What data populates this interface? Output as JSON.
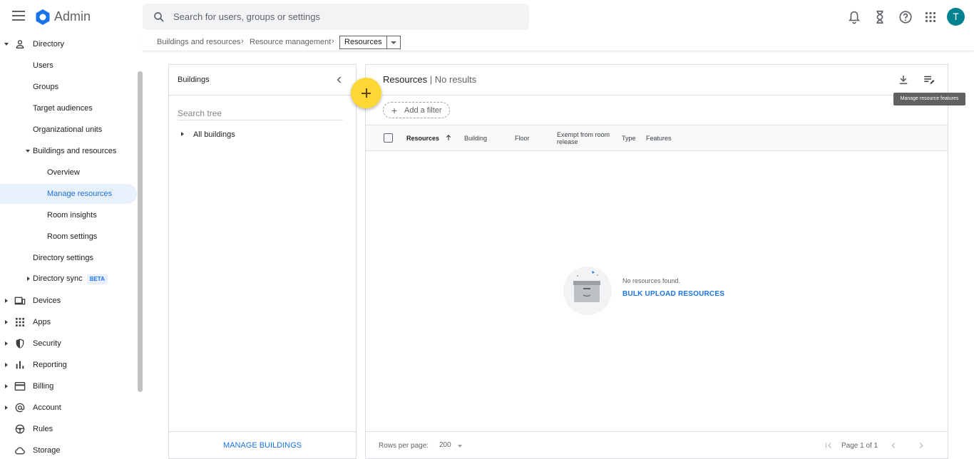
{
  "header": {
    "app_name": "Admin",
    "search_placeholder": "Search for users, groups or settings",
    "avatar_letter": "T"
  },
  "breadcrumb": {
    "items": [
      "Buildings and resources",
      "Resource management"
    ],
    "current": "Resources"
  },
  "sidebar": {
    "items": [
      {
        "label": "Directory"
      },
      {
        "label": "Users"
      },
      {
        "label": "Groups"
      },
      {
        "label": "Target audiences"
      },
      {
        "label": "Organizational units"
      },
      {
        "label": "Buildings and resources"
      },
      {
        "label": "Overview"
      },
      {
        "label": "Manage resources"
      },
      {
        "label": "Room insights"
      },
      {
        "label": "Room settings"
      },
      {
        "label": "Directory settings"
      },
      {
        "label": "Directory sync",
        "badge": "BETA"
      },
      {
        "label": "Devices"
      },
      {
        "label": "Apps"
      },
      {
        "label": "Security"
      },
      {
        "label": "Reporting"
      },
      {
        "label": "Billing"
      },
      {
        "label": "Account"
      },
      {
        "label": "Rules"
      },
      {
        "label": "Storage"
      }
    ]
  },
  "buildings_panel": {
    "title": "Buildings",
    "search_placeholder": "Search tree",
    "tree_root": "All buildings",
    "manage_label": "MANAGE BUILDINGS"
  },
  "resources_panel": {
    "title": "Resources",
    "subtitle": "| No results",
    "add_filter": "Add a filter",
    "columns": [
      "Resources",
      "Building",
      "Floor",
      "Exempt from room release",
      "Type",
      "Features"
    ],
    "empty_text": "No resources found.",
    "bulk_upload": "BULK UPLOAD RESOURCES",
    "rows_per_page_label": "Rows per page:",
    "rows_per_page_value": "200",
    "page_label": "Page 1 of 1",
    "tooltip": "Manage resource features"
  },
  "colors": {
    "accent": "#1a73e8",
    "fab": "#fdd835",
    "avatar": "#00838f"
  }
}
